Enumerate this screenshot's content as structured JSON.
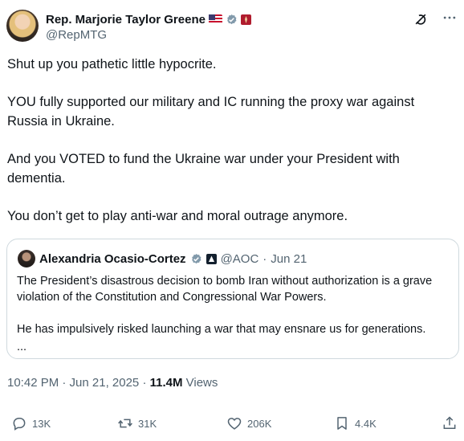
{
  "author": {
    "display_name": "Rep. Marjorie Taylor Greene",
    "handle": "@RepMTG",
    "verified_icon": "gray-verified-badge",
    "extra_badges": [
      "us-flag-emoji",
      "red-square-badge"
    ]
  },
  "tweet": {
    "paragraphs": [
      "Shut up you pathetic little hypocrite.",
      "YOU fully supported our military and IC running the proxy war against Russia in Ukraine.",
      "And you VOTED to fund the Ukraine war under your President with dementia.",
      "You don’t get to play anti-war and moral outrage anymore."
    ]
  },
  "quote": {
    "display_name": "Alexandria Ocasio-Cortez",
    "handle": "@AOC",
    "separator": "·",
    "date": "Jun 21",
    "paragraphs": [
      "The President’s disastrous decision to bomb Iran without authorization is a grave violation of the Constitution and Congressional War Powers.",
      "He has impulsively risked launching a war that may ensnare us for generations."
    ],
    "ellipsis": "..."
  },
  "meta": {
    "time_date": "10:42 PM · Jun 21, 2025 · ",
    "views_count": "11.4M",
    "views_label": " Views"
  },
  "actions": {
    "replies": "13K",
    "reposts": "31K",
    "likes": "206K",
    "bookmarks": "4.4K"
  },
  "colors": {
    "text_primary": "#0f1419",
    "text_secondary": "#536471",
    "border": "#cfd9de",
    "verified_gray": "#829aab"
  }
}
